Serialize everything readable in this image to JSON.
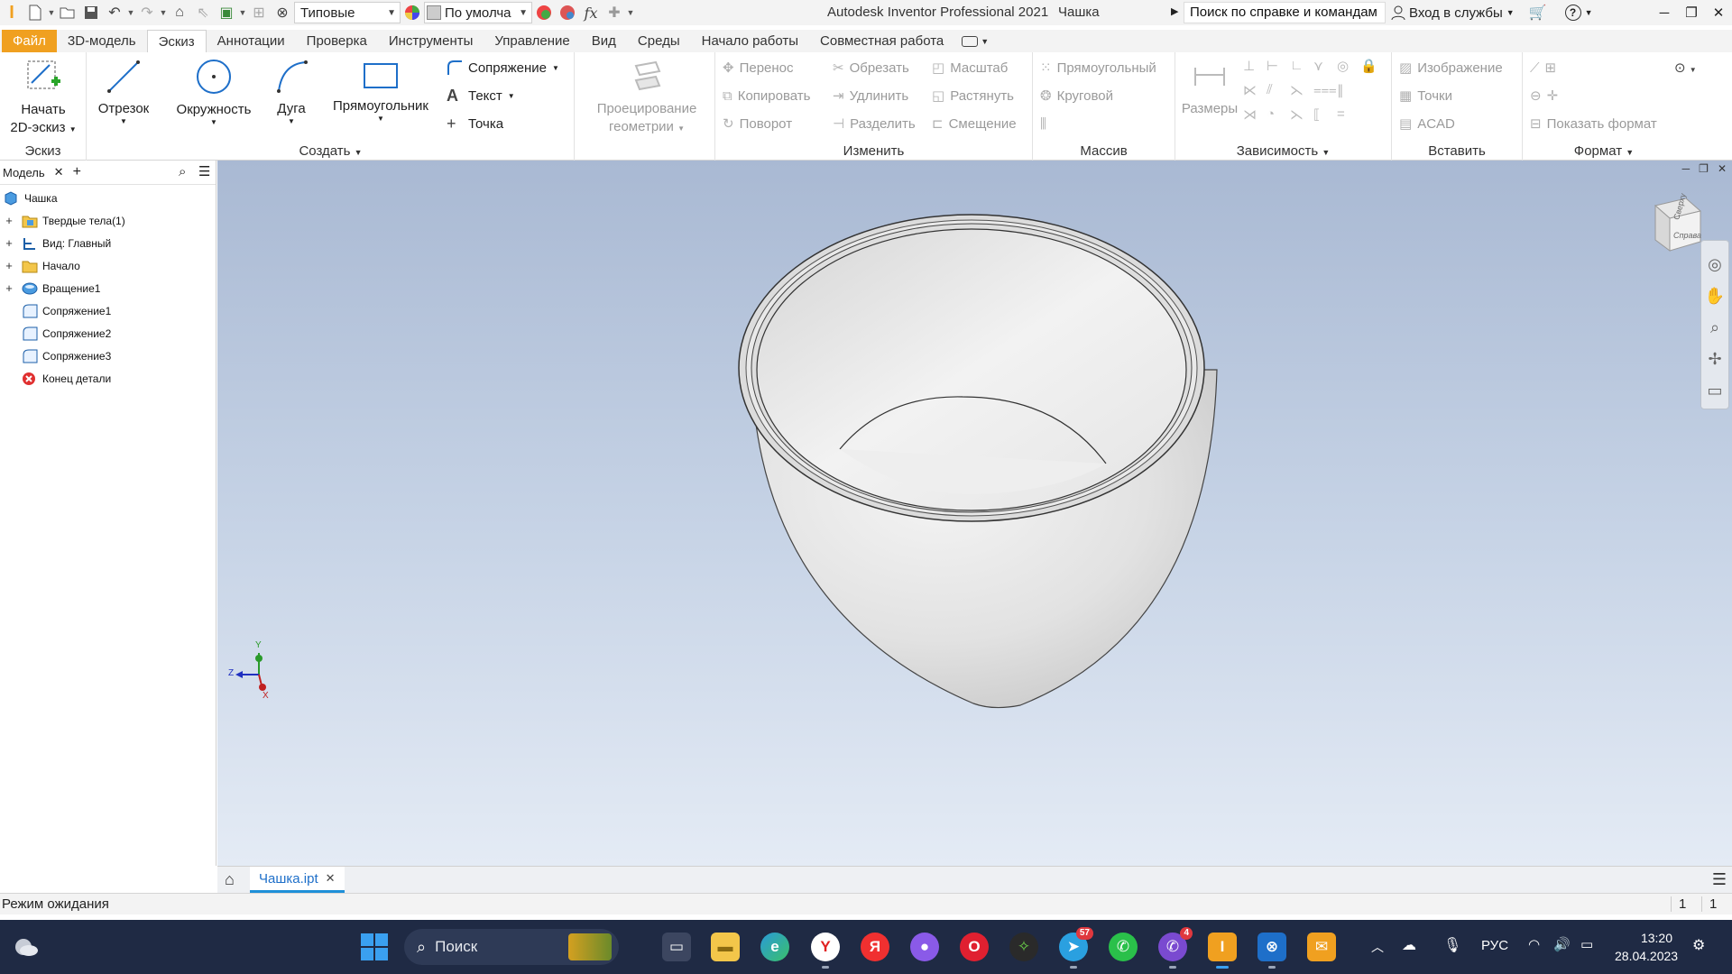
{
  "titlebar": {
    "appearance_select": "Типовые",
    "material_select": "По умолча",
    "app_title": "Autodesk Inventor Professional 2021",
    "doc_title": "Чашка",
    "search_text": "Поиск по справке и командам",
    "signin": "Вход в службы"
  },
  "tabs": [
    "Файл",
    "3D-модель",
    "Эскиз",
    "Аннотации",
    "Проверка",
    "Инструменты",
    "Управление",
    "Вид",
    "Среды",
    "Начало работы",
    "Совместная работа"
  ],
  "ribbon": {
    "sketch_panel": {
      "start": "Начать",
      "start2": "2D-эскиз",
      "title": "Эскиз"
    },
    "create_panel": {
      "title": "Создать",
      "line": "Отрезок",
      "circle": "Окружность",
      "arc": "Дуга",
      "rect": "Прямоугольник",
      "fillet": "Сопряжение",
      "text": "Текст",
      "point": "Точка",
      "project": "Проецирование",
      "project2": "геометрии"
    },
    "modify_panel": {
      "title": "Изменить",
      "move": "Перенос",
      "copy": "Копировать",
      "rotate": "Поворот",
      "trim": "Обрезать",
      "extend": "Удлинить",
      "split": "Разделить",
      "scale": "Масштаб",
      "stretch": "Растянуть",
      "offset": "Смещение"
    },
    "pattern_panel": {
      "title": "Массив",
      "rect": "Прямоугольный",
      "circ": "Круговой"
    },
    "constrain_panel": {
      "title": "Зависимость",
      "dims": "Размеры"
    },
    "insert_panel": {
      "title": "Вставить",
      "image": "Изображение",
      "points": "Точки",
      "acad": "ACAD"
    },
    "format_panel": {
      "title": "Формат",
      "show": "Показать формат"
    }
  },
  "browser": {
    "tab": "Модель",
    "tree": [
      {
        "label": "Чашка",
        "icon": "part-icon",
        "expand": ""
      },
      {
        "label": "Твердые тела(1)",
        "icon": "solid-bodies-icon",
        "expand": "+"
      },
      {
        "label": "Вид: Главный",
        "icon": "view-icon",
        "expand": "+"
      },
      {
        "label": "Начало",
        "icon": "folder-icon",
        "expand": "+"
      },
      {
        "label": "Вращение1",
        "icon": "revolve-icon",
        "expand": "+"
      },
      {
        "label": "Сопряжение1",
        "icon": "fillet-icon",
        "expand": ""
      },
      {
        "label": "Сопряжение2",
        "icon": "fillet-icon",
        "expand": ""
      },
      {
        "label": "Сопряжение3",
        "icon": "fillet-icon",
        "expand": ""
      },
      {
        "label": "Конец детали",
        "icon": "end-of-part-icon",
        "expand": ""
      }
    ]
  },
  "viewcube": {
    "top": "Сверху",
    "right": "Справа"
  },
  "triad": {
    "y": "Y",
    "z": "Z",
    "x": "X"
  },
  "doc_tab": "Чашка.ipt",
  "status": {
    "text": "Режим ожидания",
    "num1": "1",
    "num2": "1"
  },
  "taskbar": {
    "search": "Поиск",
    "telegram_badge": "57",
    "viber_badge": "4",
    "lang": "РУС",
    "time": "13:20",
    "date": "28.04.2023"
  },
  "colors": {
    "accent": "#f0a020",
    "taskbar": "#1f2a44",
    "viewport_top": "#a9b9d3"
  }
}
